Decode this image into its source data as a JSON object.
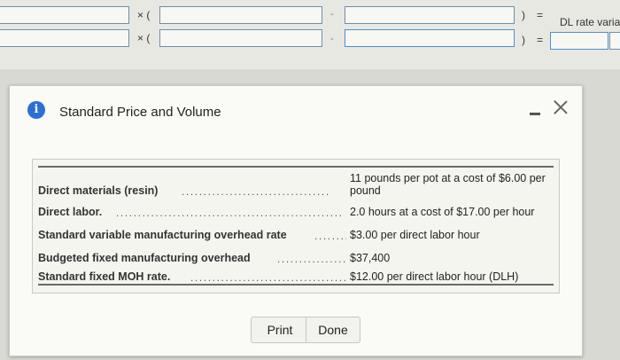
{
  "background_form": {
    "row1": {
      "multiply": "× (",
      "separator": "-",
      "close": ")",
      "equals": "="
    },
    "row2": {
      "multiply": "× (",
      "separator": "-",
      "close": ")",
      "equals": "="
    },
    "tail_label": "DL rate varia"
  },
  "modal": {
    "title": "Standard Price and Volume",
    "rows": [
      {
        "label": "Direct materials (resin)",
        "value_line1": "11 pounds per pot at a cost of $6.00 per",
        "value_line2": "pound"
      },
      {
        "label": "Direct labor.",
        "value_line1": "2.0 hours at a cost of $17.00 per hour"
      },
      {
        "label": "Standard variable manufacturing overhead rate",
        "value_line1": "$3.00 per direct labor hour"
      },
      {
        "label": "Budgeted fixed manufacturing overhead",
        "value_line1": "$37,400"
      },
      {
        "label": "Standard fixed MOH rate.",
        "value_line1": "$12.00 per direct labor hour (DLH)"
      }
    ],
    "buttons": {
      "print": "Print",
      "done": "Done"
    }
  },
  "icons": {
    "info": "info-icon",
    "minimize": "minimize-icon",
    "close": "close-icon"
  },
  "colors": {
    "info_blue": "#2a6fd6",
    "field_border": "#6f8fa8"
  }
}
